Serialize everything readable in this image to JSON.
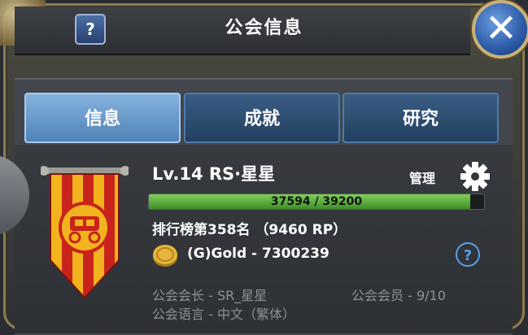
{
  "window": {
    "title": "公会信息",
    "help_label": "?",
    "close_label": "✕"
  },
  "tabs": [
    {
      "label": "信息",
      "active": true
    },
    {
      "label": "成就",
      "active": false
    },
    {
      "label": "研究",
      "active": false
    }
  ],
  "guild": {
    "name": "Lv.14  RS·星星",
    "manage_label": "管理",
    "exp": {
      "current": 37594,
      "max": 39200,
      "text": "37594 / 39200"
    },
    "rank_text": "排行榜第358名 （9460 RP）",
    "gold_text": "(G)Gold - 7300239",
    "help_label": "?",
    "leader_text": "公会会长 - SR_星星",
    "members_text": "公会会员 - 9/10",
    "language_text": "公会语言 - 中文（繁体）"
  },
  "colors": {
    "tab_active": "#6fa0d1",
    "tab_inactive": "#2e4d70",
    "exp_bar": "#5fb33f",
    "banner_red": "#c8241b",
    "banner_yellow": "#f2b31e"
  },
  "icons": {
    "close": "close-icon",
    "help": "help-icon",
    "settings": "gear-icon",
    "currency": "gold-coin-icon",
    "guild_emblem": "carriage-banner-icon"
  }
}
